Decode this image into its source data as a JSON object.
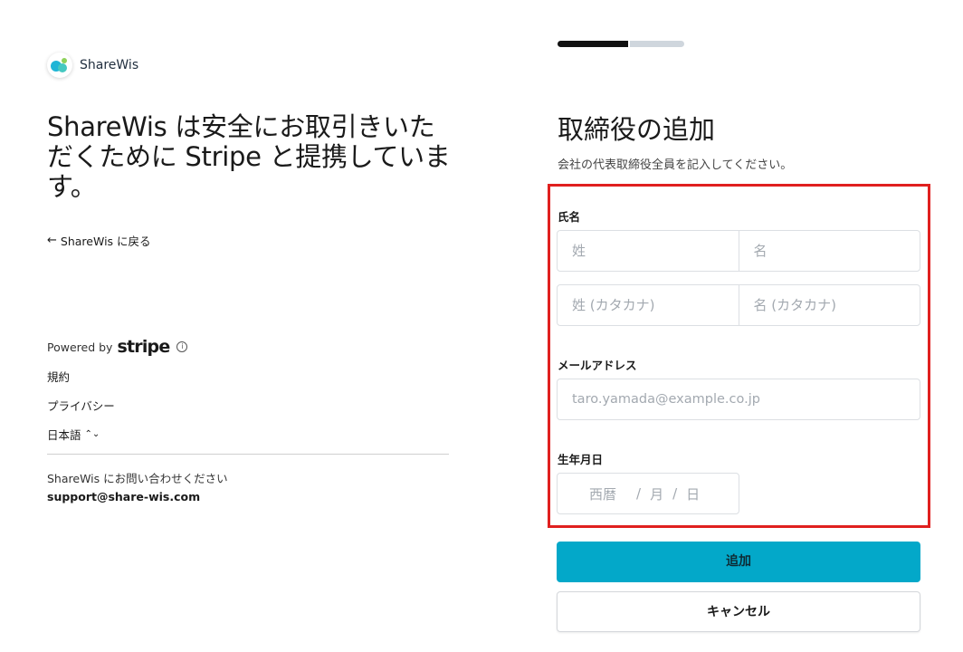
{
  "brand": {
    "name": "ShareWis",
    "logo_icon": "sharewis-logo-icon"
  },
  "left": {
    "headline": "ShareWis は安全にお取引きいただくために Stripe と提携しています。",
    "back_link": "ShareWis に戻る",
    "powered_by": "Powered by",
    "stripe": "stripe",
    "terms": "規約",
    "privacy": "プライバシー",
    "language": "日本語",
    "contact_text": "ShareWis にお問い合わせください",
    "contact_email": "support@share-wis.com"
  },
  "progress": {
    "current_step": 1,
    "total_steps": 2,
    "fraction": 0.56
  },
  "form": {
    "title": "取締役の追加",
    "subtitle": "会社の代表取締役全員を記入してください。",
    "name_label": "氏名",
    "last_name_placeholder": "姓",
    "first_name_placeholder": "名",
    "last_name_kana_placeholder": "姓 (カタカナ)",
    "first_name_kana_placeholder": "名 (カタカナ)",
    "email_label": "メールアドレス",
    "email_placeholder": "taro.yamada@example.co.jp",
    "dob_label": "生年月日",
    "dob_year": "西暦",
    "dob_month": "月",
    "dob_day": "日",
    "dob_sep": "/",
    "submit": "追加",
    "cancel": "キャンセル"
  },
  "colors": {
    "accent": "#03a8c9",
    "highlight": "#e0201f",
    "progress_done": "#111111",
    "progress_todo": "#cfd6dd"
  }
}
